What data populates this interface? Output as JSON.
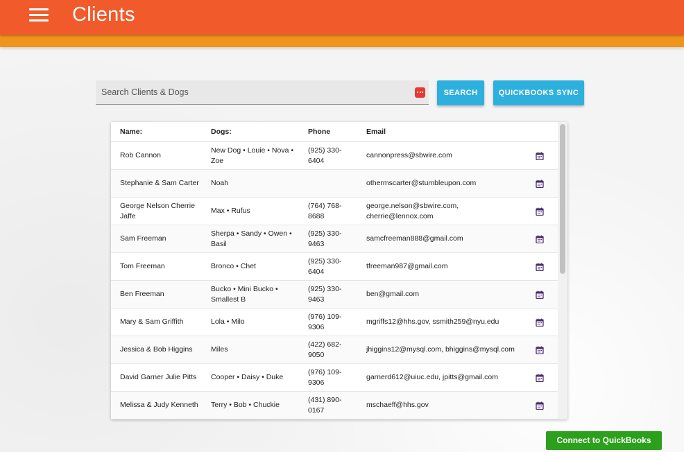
{
  "header": {
    "title": "Clients"
  },
  "search": {
    "placeholder": "Search Clients & Dogs",
    "value": ""
  },
  "buttons": {
    "search": "SEARCH",
    "quickbooks_sync": "QUICKBOOKS SYNC",
    "connect_quickbooks": "Connect to QuickBooks"
  },
  "table": {
    "headers": {
      "name": "Name:",
      "dogs": "Dogs:",
      "phone": "Phone",
      "email": "Email"
    },
    "rows": [
      {
        "name": "Rob Cannon",
        "dogs": "New Dog • Louie • Nova • Zoe",
        "phone": "(925) 330-6404",
        "email": "cannonpress@sbwire.com"
      },
      {
        "name": "Stephanie & Sam Carter",
        "dogs": "Noah",
        "phone": "",
        "email": "othermscarter@stumbleupon.com"
      },
      {
        "name": "George Nelson Cherrie Jaffe",
        "dogs": "Max • Rufus",
        "phone": "(764) 768-8688",
        "email": "george.nelson@sbwire.com, cherrie@lennox.com"
      },
      {
        "name": "Sam Freeman",
        "dogs": "Sherpa • Sandy • Owen • Basil",
        "phone": "(925) 330-9463",
        "email": "samcfreeman888@gmail.com"
      },
      {
        "name": "Tom Freeman",
        "dogs": "Bronco • Chet",
        "phone": "(925) 330-6404",
        "email": "tfreeman987@gmail.com"
      },
      {
        "name": "Ben Freeman",
        "dogs": "Bucko • Mini Bucko • Smallest B",
        "phone": "(925) 330-9463",
        "email": "ben@gmail.com"
      },
      {
        "name": "Mary & Sam Griffith",
        "dogs": "Lola • Milo",
        "phone": "(976) 109-9306",
        "email": "mgriffs12@hhs.gov, ssmith259@nyu.edu"
      },
      {
        "name": "Jessica & Bob Higgins",
        "dogs": "Miles",
        "phone": "(422) 682-9050",
        "email": "jhiggins12@mysql.com, bhiggins@mysql.com"
      },
      {
        "name": "David Garner Julie Pitts",
        "dogs": "Cooper • Daisy • Duke",
        "phone": "(976) 109-9306",
        "email": "garnerd612@uiuc.edu, jpitts@gmail.com"
      },
      {
        "name": "Melissa & Judy Kenneth",
        "dogs": "Terry • Bob • Chuckie",
        "phone": "(431) 890-0167",
        "email": "mschaeff@hhs.gov"
      }
    ]
  },
  "icons": {
    "menu": "hamburger-menu-icon",
    "search_field": "password-dots-icon",
    "row_action": "calendar-icon"
  },
  "colors": {
    "header": "#f15a2b",
    "header_stripe": "#f0941d",
    "primary_button": "#2eb0de",
    "quickbooks_button": "#2ca01c",
    "calendar_icon": "#4a2c6e"
  }
}
